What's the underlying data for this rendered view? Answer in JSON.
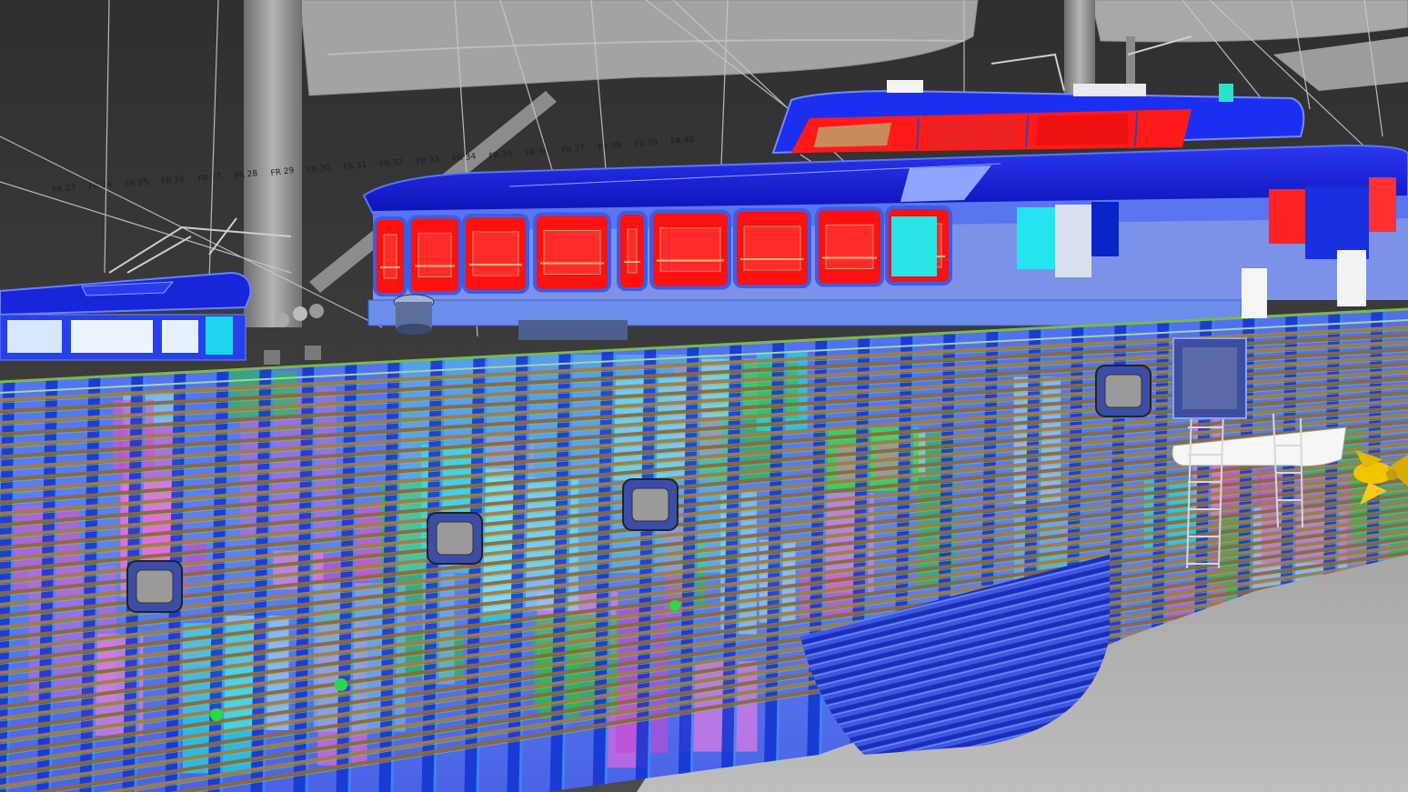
{
  "scene": {
    "subject": "",
    "colors": {
      "background_dark": "#3c3c3c",
      "floor": "#a8a8a8",
      "roof_blue": "#1515d8",
      "window_red": "#ff0a0a",
      "hull_blue": "#5b7ff0",
      "frame_blue": "#0a3fd6",
      "stringer_brown": "#8d6a3a",
      "magenta": "#d05ac8",
      "cyan": "#19e6e6",
      "green": "#2bbf4a",
      "propeller_yellow": "#f2c400",
      "mast_gray": "#8e8e8e",
      "sail_gray": "#a3a3a3"
    }
  },
  "frame_labels": [
    "FR 23",
    "FR 24",
    "FR 25",
    "FR 26",
    "FR 27",
    "FR 28",
    "FR 29",
    "FR 30",
    "FR 31",
    "FR 32",
    "FR 33",
    "FR 34",
    "FR 35",
    "FR 36",
    "FR 37",
    "FR 38",
    "FR 39",
    "FR 40"
  ]
}
